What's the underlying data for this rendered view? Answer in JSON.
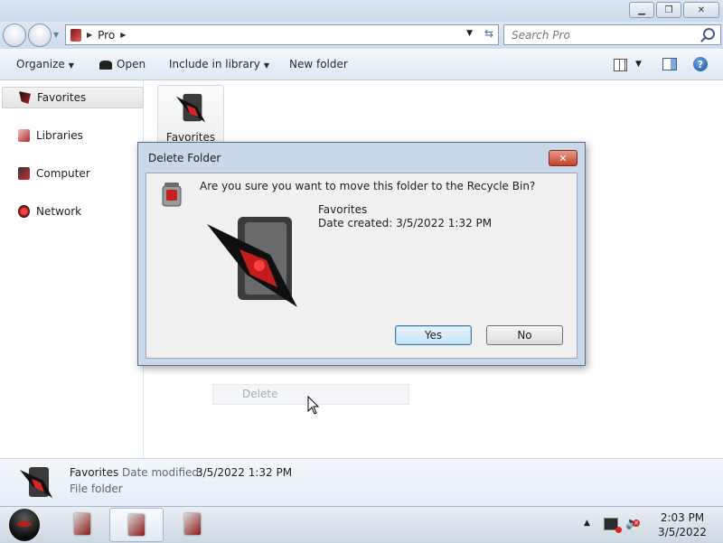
{
  "window": {
    "caption_buttons": [
      "minimize",
      "maximize",
      "close"
    ]
  },
  "address": {
    "path": "Pro",
    "search_placeholder": "Search Pro"
  },
  "toolbar": {
    "organize": "Organize",
    "open": "Open",
    "include_in_library": "Include in library",
    "new_folder": "New folder"
  },
  "nav": {
    "items": [
      {
        "label": "Favorites"
      },
      {
        "label": "Libraries"
      },
      {
        "label": "Computer"
      },
      {
        "label": "Network"
      }
    ]
  },
  "content": {
    "folder_label": "Favorites",
    "context_menu_remnant": "Delete"
  },
  "details": {
    "name": "Favorites",
    "modified_label": "Date modified:",
    "modified_value": "3/5/2022 1:32 PM",
    "type": "File folder"
  },
  "dialog": {
    "title": "Delete Folder",
    "question": "Are you sure you want to move this folder to the Recycle Bin?",
    "item_name": "Favorites",
    "item_date": "Date created: 3/5/2022 1:32 PM",
    "yes": "Yes",
    "no": "No"
  },
  "taskbar": {
    "time": "2:03 PM",
    "date": "3/5/2022"
  },
  "colors": {
    "accent": "#b91c1c",
    "window_frame": "#c9d7e8",
    "toolbar_bg": "#e4ecf6"
  }
}
